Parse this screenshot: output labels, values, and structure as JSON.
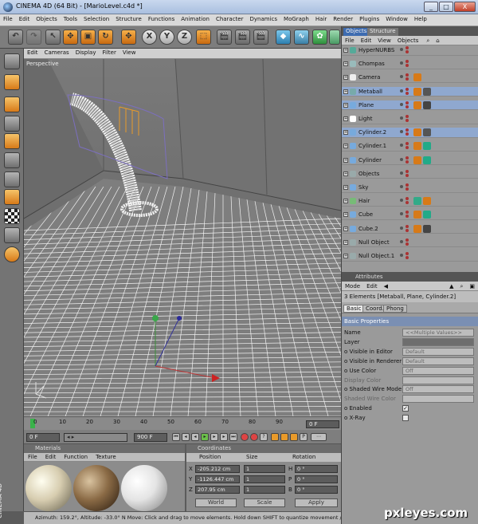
{
  "window": {
    "title": "CINEMA 4D (64 Bit) - [MarioLevel.c4d *]",
    "buttons": [
      "_",
      "□",
      "X"
    ]
  },
  "menubar": [
    "File",
    "Edit",
    "Objects",
    "Tools",
    "Selection",
    "Structure",
    "Functions",
    "Animation",
    "Character",
    "Dynamics",
    "MoGraph",
    "Hair",
    "Render",
    "Plugins",
    "Window",
    "Help"
  ],
  "viewport": {
    "menu": [
      "Edit",
      "Cameras",
      "Display",
      "Filter",
      "View"
    ],
    "label": "Perspective"
  },
  "timeline": {
    "ticks": [
      "0",
      "10",
      "20",
      "30",
      "40",
      "50",
      "60",
      "70",
      "80",
      "90"
    ],
    "current_frame": "0 F"
  },
  "transport": {
    "start_field": "0 F",
    "end_field": "900 F"
  },
  "materials": {
    "header": "Materials",
    "menu": [
      "File",
      "Edit",
      "Function",
      "Texture"
    ]
  },
  "coordinates": {
    "header": "Coordinates",
    "columns": [
      "Position",
      "Size",
      "Rotation"
    ],
    "rows": [
      {
        "axis": "X",
        "pos": "-205.212 cm",
        "size": "1",
        "rot_axis": "H",
        "rot": "0 °"
      },
      {
        "axis": "Y",
        "pos": "-1126.447 cm",
        "size": "1",
        "rot_axis": "P",
        "rot": "0 °"
      },
      {
        "axis": "Z",
        "pos": "207.95 cm",
        "size": "1",
        "rot_axis": "B",
        "rot": "0 °"
      }
    ],
    "mode1": "World",
    "mode2": "Scale",
    "apply": "Apply"
  },
  "status": "Azimuth: 159.2°, Altitude: -33.0°  N    Move: Click and drag to move elements. Hold down SHIFT to quantize movement / add to",
  "objects_panel": {
    "tabs": [
      "Objects",
      "Structure"
    ],
    "menu": [
      "File",
      "Edit",
      "View",
      "Objects"
    ],
    "items": [
      {
        "name": "HyperNURBS",
        "color": "#5a9"
      },
      {
        "name": "Chompas",
        "color": "#9bb"
      },
      {
        "name": "Camera",
        "color": "#eee"
      },
      {
        "name": "Metaball",
        "color": "#7aa"
      },
      {
        "name": "Plane",
        "color": "#7ad"
      },
      {
        "name": "Light",
        "color": "#fff"
      },
      {
        "name": "Cylinder.2",
        "color": "#7ad"
      },
      {
        "name": "Cylinder.1",
        "color": "#7ad"
      },
      {
        "name": "Cylinder",
        "color": "#7ad"
      },
      {
        "name": "Objects",
        "color": "#9aa"
      },
      {
        "name": "Sky",
        "color": "#7ad"
      },
      {
        "name": "Hair",
        "color": "#7b7"
      },
      {
        "name": "Cube",
        "color": "#7ad"
      },
      {
        "name": "Cube.2",
        "color": "#7ad"
      },
      {
        "name": "Null Object",
        "color": "#9aa"
      },
      {
        "name": "Null Object.1",
        "color": "#9aa"
      }
    ]
  },
  "attributes": {
    "header": "Attributes",
    "menu": [
      "Mode",
      "Edit"
    ],
    "selection": "3 Elements [Metaball, Plane, Cylinder.2]",
    "tabs": [
      "Basic",
      "Coord.",
      "Phong"
    ],
    "section": "Basic Properties",
    "rows": [
      {
        "label": "Name",
        "value": "<<Multiple Values>>"
      },
      {
        "label": "Layer",
        "value": ""
      },
      {
        "label": "o Visible in Editor",
        "value": "Default"
      },
      {
        "label": "o Visible in Renderer",
        "value": "Default"
      },
      {
        "label": "o Use Color",
        "value": "Off"
      },
      {
        "label": "Display Color",
        "value": ""
      },
      {
        "label": "o Shaded Wire Mode",
        "value": "Off"
      },
      {
        "label": "Shaded Wire Color",
        "value": ""
      },
      {
        "label": "o Enabled",
        "value": "✓"
      },
      {
        "label": "o X-Ray",
        "value": ""
      }
    ]
  },
  "watermark": "pxleyes.com",
  "colors": {
    "accent": "#3d6bb0",
    "viewport_bg": "#6e6e6e",
    "grid": "#ffffff"
  }
}
